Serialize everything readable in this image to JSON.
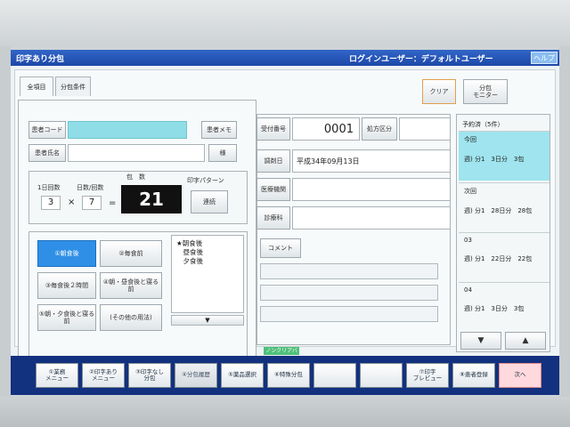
{
  "window": {
    "title": "印字あり分包",
    "login": "ログインユーザー：デフォルトユーザー",
    "help": "ヘルプ"
  },
  "tabs": [
    "全項目",
    "分包条件"
  ],
  "top_buttons": {
    "clear": "クリア",
    "bunpu_monitor": "分包\nモニター"
  },
  "patient": {
    "code_label": "患者コード",
    "code_value": "",
    "name_label": "患者氏名",
    "name_value": "",
    "memo_button": "患者メモ",
    "name_button": "様"
  },
  "dose": {
    "per_day_label": "1日回数",
    "days_label": "日数/回数",
    "count_label": "包　数",
    "per_day": "3",
    "times": "×",
    "days": "7",
    "equals": "=",
    "packets": "21",
    "print_pattern_label": "印字パターン",
    "print_pattern_value": "連続"
  },
  "timing_buttons": [
    "①朝食後",
    "②毎食前",
    "③毎食後２時間",
    "④朝・昼食後と寝る前",
    "⑤朝・夕食後と寝る前",
    "(その他の用法)"
  ],
  "memo_lines": [
    "★朝食後",
    "　昼食後",
    "　夕食後"
  ],
  "memo_down": "▼",
  "reception": {
    "number_label": "受付番号",
    "number_value": "0001",
    "prescription_class": "処方区分",
    "date_label": "調剤日",
    "date_value": "平成34年09月13日",
    "institution_label": "医療機関",
    "institution_value": "",
    "department_label": "診療科",
    "department_value": "",
    "comment_label": "コメント"
  },
  "history": {
    "title": "予約済（5件）",
    "items": [
      {
        "header": "今回",
        "detail": "週) 分1　3日分　3包"
      },
      {
        "header": "次回",
        "detail": "週) 分1　28日分　28包"
      },
      {
        "header": "03",
        "detail": "週) 分1　22日分　22包"
      },
      {
        "header": "04",
        "detail": "週) 分1　3日分　3包"
      }
    ],
    "down": "▼",
    "up": "▲"
  },
  "strip_label": "ノンクリアバン",
  "function_keys": [
    "①業務\nメニュー",
    "②印字あり\nメニュー",
    "③印字なし\n分包",
    "④分包履歴",
    "⑤薬品選択",
    "⑥特殊分包",
    "",
    "",
    "⑦印字\nプレビュー",
    "⑧患者登録",
    "次へ"
  ]
}
